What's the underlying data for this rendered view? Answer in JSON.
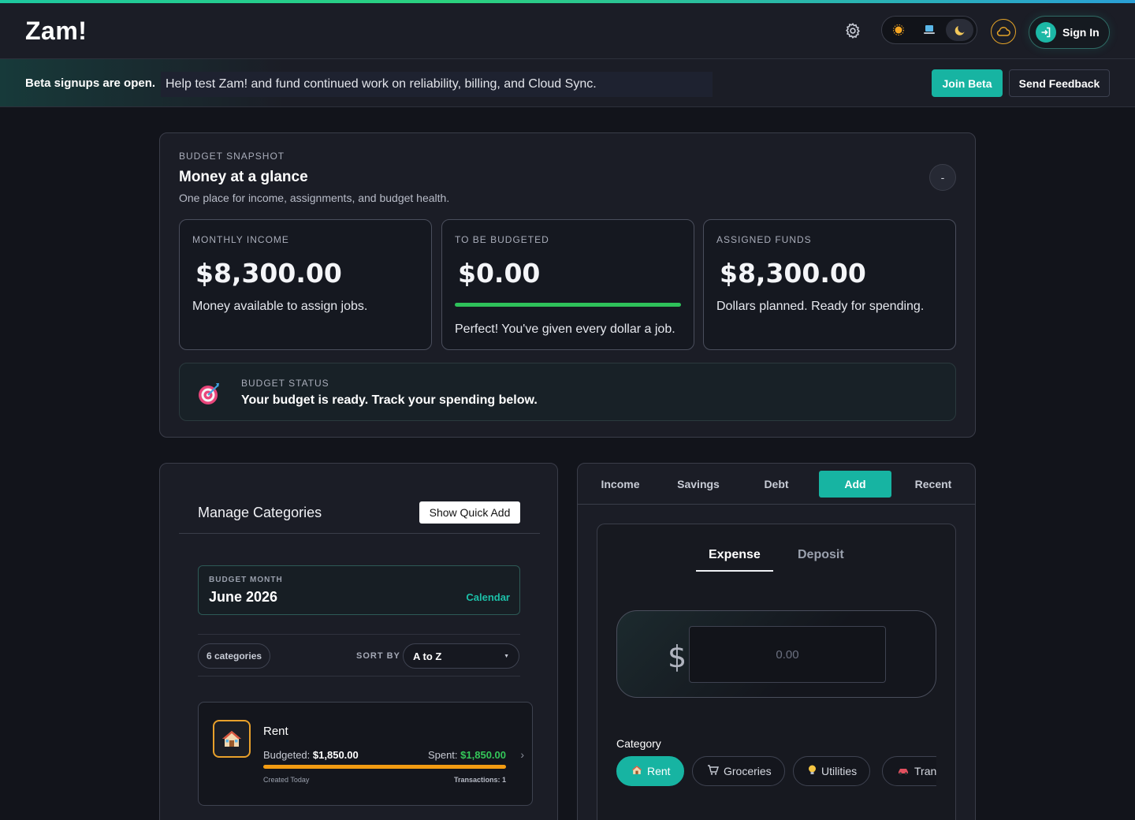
{
  "header": {
    "brand": "Zam!",
    "signin_label": "Sign In"
  },
  "beta": {
    "title": "Beta signups are open.",
    "message": "Help test Zam! and fund continued work on reliability, billing, and Cloud Sync.",
    "join_label": "Join Beta",
    "feedback_label": "Send Feedback"
  },
  "snapshot": {
    "eyebrow": "BUDGET SNAPSHOT",
    "title": "Money at a glance",
    "subtitle": "One place for income, assignments, and budget health.",
    "collapse_label": "-",
    "cards": [
      {
        "eyebrow": "MONTHLY INCOME",
        "value": "$8,300.00",
        "note": "Money available to assign jobs."
      },
      {
        "eyebrow": "TO BE BUDGETED",
        "value": "$0.00",
        "note": "Perfect! You've given every dollar a job.",
        "progress": 1.0
      },
      {
        "eyebrow": "ASSIGNED FUNDS",
        "value": "$8,300.00",
        "note": "Dollars planned. Ready for spending."
      }
    ],
    "status": {
      "eyebrow": "BUDGET STATUS",
      "text": "Your budget is ready. Track your spending below."
    }
  },
  "categories": {
    "title": "Manage Categories",
    "quick_add_label": "Show Quick Add",
    "month": {
      "eyebrow": "BUDGET MONTH",
      "value": "June 2026",
      "calendar_label": "Calendar"
    },
    "count_label": "6 categories",
    "sort_label": "SORT BY",
    "sort_value": "A to Z",
    "items": [
      {
        "name": "Rent",
        "budgeted_label": "Budgeted:",
        "budgeted": "$1,850.00",
        "spent_label": "Spent:",
        "spent": "$1,850.00",
        "created": "Created Today",
        "transactions": "Transactions: 1",
        "progress": 1.0
      }
    ]
  },
  "transaction": {
    "tabs": [
      "Income",
      "Savings",
      "Debt",
      "Add",
      "Recent"
    ],
    "active_tab": "Add",
    "subtabs": [
      "Expense",
      "Deposit"
    ],
    "active_subtab": "Expense",
    "currency_symbol": "$",
    "amount_placeholder": "0.00",
    "category_label": "Category",
    "category_chips": [
      "Rent",
      "Groceries",
      "Utilities",
      "Tran"
    ],
    "active_chip": "Rent"
  },
  "colors": {
    "accent": "#17b4a2",
    "success": "#2ec15a",
    "warning": "#f39c12",
    "background": "#12141b"
  },
  "icons": {
    "settings": "gear-icon",
    "theme_light": "sun-icon",
    "theme_system": "laptop-icon",
    "theme_dark": "moon-icon",
    "cloud_sync": "cloud-icon",
    "signin": "login-arrow-icon",
    "budget_status": "target-icon",
    "rent": "house-icon",
    "groceries": "cart-icon",
    "utilities": "lightbulb-icon",
    "transport": "car-icon"
  }
}
